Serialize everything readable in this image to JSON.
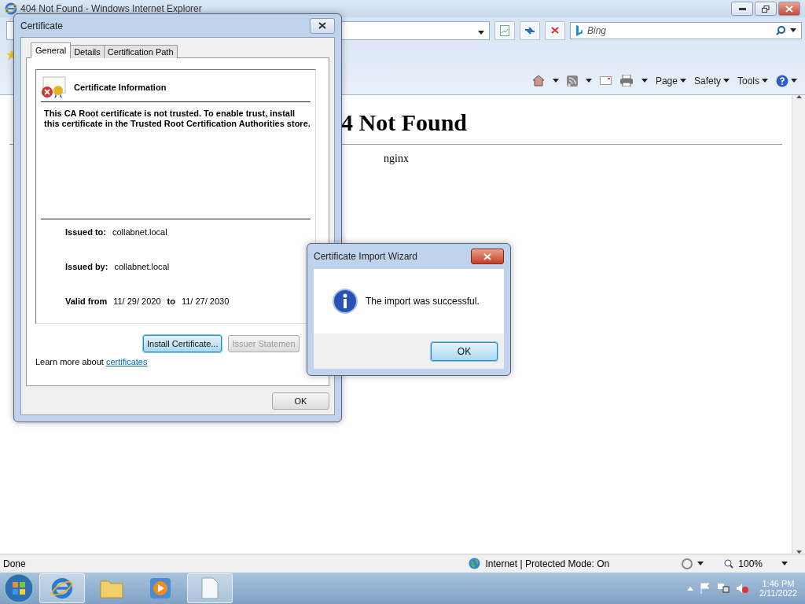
{
  "browser": {
    "title": "404 Not Found - Windows Internet Explorer",
    "search_placeholder": "Bing",
    "command_menus": [
      "Page",
      "Safety",
      "Tools"
    ],
    "page": {
      "heading": "4 Not Found",
      "footer": "nginx"
    },
    "status_bar": {
      "status": "Done",
      "zone": "Internet | Protected Mode: On",
      "zoom": "100%"
    }
  },
  "certificate_dialog": {
    "title": "Certificate",
    "tabs": [
      {
        "label": "General",
        "selected": true
      },
      {
        "label": "Details",
        "selected": false
      },
      {
        "label": "Certification Path",
        "selected": false
      }
    ],
    "info_title": "Certificate Information",
    "warning": "This CA Root certificate is not trusted. To enable trust, install this certificate in the Trusted Root Certification Authorities store.",
    "fields": [
      {
        "label": "Issued to:",
        "value": "collabnet.local"
      },
      {
        "label": "Issued by:",
        "value": "collabnet.local"
      }
    ],
    "validity": {
      "from_label": "Valid from",
      "from": "11/ 29/ 2020",
      "to_label": "to",
      "to": "11/ 27/ 2030"
    },
    "buttons": [
      {
        "label": "Install Certificate...",
        "disabled": false,
        "focused": true
      },
      {
        "label": "Issuer Statemen",
        "disabled": true,
        "focused": false
      }
    ],
    "learn_more": "Learn more about",
    "link": "certificates",
    "ok": "OK"
  },
  "wizard": {
    "title": "Certificate Import Wizard",
    "message": "The import was successful.",
    "ok": "OK"
  },
  "taskbar": {
    "time": "1:46 PM",
    "date": "2/11/2022"
  }
}
